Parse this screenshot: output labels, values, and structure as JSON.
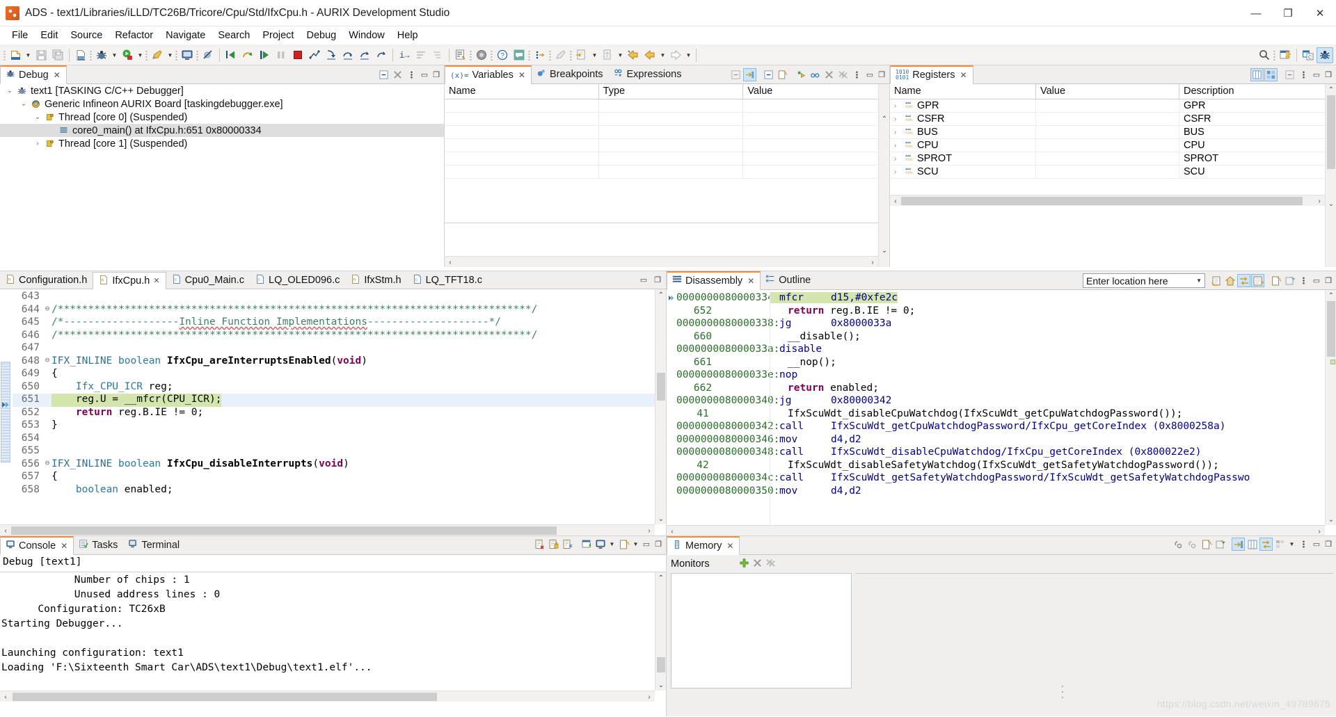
{
  "window": {
    "title": "ADS - text1/Libraries/iLLD/TC26B/Tricore/Cpu/Std/IfxCpu.h - AURIX Development Studio",
    "minimize": "—",
    "maximize": "❐",
    "close": "✕"
  },
  "menu": [
    "File",
    "Edit",
    "Source",
    "Refactor",
    "Navigate",
    "Search",
    "Project",
    "Debug",
    "Window",
    "Help"
  ],
  "debug_view": {
    "tab": "Debug",
    "tree": [
      {
        "indent": 0,
        "twisty": "⌄",
        "icon": "debug-launch-icon",
        "label": "text1 [TASKING C/C++ Debugger]",
        "selected": false
      },
      {
        "indent": 1,
        "twisty": "⌄",
        "icon": "target-board-icon",
        "label": "Generic Infineon AURIX Board [taskingdebugger.exe]",
        "selected": false
      },
      {
        "indent": 2,
        "twisty": "⌄",
        "icon": "thread-icon",
        "label": "Thread [core 0] (Suspended)",
        "selected": false
      },
      {
        "indent": 3,
        "twisty": "",
        "icon": "stack-frame-icon",
        "label": "core0_main() at IfxCpu.h:651 0x80000334",
        "selected": true
      },
      {
        "indent": 2,
        "twisty": "›",
        "icon": "thread-icon",
        "label": "Thread [core 1] (Suspended)",
        "selected": false
      }
    ]
  },
  "variables_view": {
    "tabs": [
      {
        "label": "Variables",
        "icon": "variables-icon",
        "selected": true,
        "closable": true
      },
      {
        "label": "Breakpoints",
        "icon": "breakpoints-icon",
        "selected": false,
        "closable": false
      },
      {
        "label": "Expressions",
        "icon": "expressions-icon",
        "selected": false,
        "closable": false
      }
    ],
    "columns": [
      "Name",
      "Type",
      "Value"
    ],
    "rows": [
      [],
      [],
      [],
      [],
      [],
      []
    ]
  },
  "registers_view": {
    "tab": "Registers",
    "columns": [
      "Name",
      "Value",
      "Description"
    ],
    "rows": [
      {
        "name": "GPR",
        "value": "",
        "description": "GPR"
      },
      {
        "name": "CSFR",
        "value": "",
        "description": "CSFR"
      },
      {
        "name": "BUS",
        "value": "",
        "description": "BUS"
      },
      {
        "name": "CPU",
        "value": "",
        "description": "CPU"
      },
      {
        "name": "SPROT",
        "value": "",
        "description": "SPROT"
      },
      {
        "name": "SCU",
        "value": "",
        "description": "SCU"
      }
    ]
  },
  "editor": {
    "tabs": [
      {
        "label": "Configuration.h",
        "type": "h",
        "selected": false,
        "closable": false
      },
      {
        "label": "IfxCpu.h",
        "type": "h",
        "selected": true,
        "closable": true
      },
      {
        "label": "Cpu0_Main.c",
        "type": "c",
        "selected": false,
        "closable": false
      },
      {
        "label": "LQ_OLED096.c",
        "type": "c",
        "selected": false,
        "closable": false
      },
      {
        "label": "IfxStm.h",
        "type": "h",
        "selected": false,
        "closable": false
      },
      {
        "label": "LQ_TFT18.c",
        "type": "c",
        "selected": false,
        "closable": false
      }
    ],
    "lines": [
      {
        "no": "643",
        "fold": "",
        "text": "",
        "style": "plain",
        "highlight": "none"
      },
      {
        "no": "644",
        "fold": "⊖",
        "text": "/******************************************************************************/",
        "style": "comment",
        "highlight": "none"
      },
      {
        "no": "645",
        "fold": "",
        "text": "/*-------------------Inline Function Implementations--------------------*/",
        "style": "comment-underline",
        "highlight": "none"
      },
      {
        "no": "646",
        "fold": "",
        "text": "/******************************************************************************/",
        "style": "comment",
        "highlight": "none"
      },
      {
        "no": "647",
        "fold": "",
        "text": "",
        "style": "plain",
        "highlight": "none"
      },
      {
        "no": "648",
        "fold": "⊖",
        "text": "IFX_INLINE boolean IfxCpu_areInterruptsEnabled(void)",
        "style": "decl",
        "highlight": "none"
      },
      {
        "no": "649",
        "fold": "",
        "text": "{",
        "style": "plain",
        "highlight": "none"
      },
      {
        "no": "650",
        "fold": "",
        "text": "    Ifx_CPU_ICR reg;",
        "style": "plain",
        "highlight": "none"
      },
      {
        "no": "651",
        "fold": "",
        "text": "    reg.U = __mfcr(CPU_ICR);",
        "style": "plain",
        "highlight": "current"
      },
      {
        "no": "652",
        "fold": "",
        "text": "    return reg.B.IE != 0;",
        "style": "ret",
        "highlight": "none"
      },
      {
        "no": "653",
        "fold": "",
        "text": "}",
        "style": "plain",
        "highlight": "none"
      },
      {
        "no": "654",
        "fold": "",
        "text": "",
        "style": "plain",
        "highlight": "none"
      },
      {
        "no": "655",
        "fold": "",
        "text": "",
        "style": "plain",
        "highlight": "none"
      },
      {
        "no": "656",
        "fold": "⊖",
        "text": "IFX_INLINE boolean IfxCpu_disableInterrupts(void)",
        "style": "decl",
        "highlight": "none"
      },
      {
        "no": "657",
        "fold": "",
        "text": "{",
        "style": "plain",
        "highlight": "none"
      },
      {
        "no": "658",
        "fold": "",
        "text": "    boolean enabled;",
        "style": "plain",
        "highlight": "none"
      }
    ]
  },
  "disassembly_view": {
    "tabs": [
      {
        "label": "Disassembly",
        "icon": "disassembly-icon",
        "selected": true,
        "closable": true
      },
      {
        "label": "Outline",
        "icon": "outline-icon",
        "selected": false,
        "closable": false
      }
    ],
    "location_placeholder": "Enter location here",
    "rows": [
      {
        "kind": "instr",
        "marker": true,
        "addr": "0000000080000334:",
        "op": "mfcr",
        "arg": "d15,#0xfe2c",
        "highlight": true
      },
      {
        "kind": "source",
        "lineno": "652",
        "text": "return reg.B.IE != 0;",
        "keyword": "return"
      },
      {
        "kind": "instr",
        "marker": false,
        "addr": "0000000080000338:",
        "op": "jg",
        "arg": "0x8000033a",
        "highlight": false
      },
      {
        "kind": "source",
        "lineno": "660",
        "text": "__disable();",
        "keyword": ""
      },
      {
        "kind": "instr",
        "marker": false,
        "addr": "000000008000033a:",
        "op": "disable",
        "arg": "",
        "highlight": false
      },
      {
        "kind": "source",
        "lineno": "661",
        "text": "__nop();",
        "keyword": ""
      },
      {
        "kind": "instr",
        "marker": false,
        "addr": "000000008000033e:",
        "op": "nop",
        "arg": "",
        "highlight": false
      },
      {
        "kind": "source",
        "lineno": "662",
        "text": "return enabled;",
        "keyword": "return"
      },
      {
        "kind": "instr",
        "marker": false,
        "addr": "0000000080000340:",
        "op": "jg",
        "arg": "0x80000342",
        "highlight": false
      },
      {
        "kind": "source",
        "lineno": "41",
        "text": "IfxScuWdt_disableCpuWatchdog(IfxScuWdt_getCpuWatchdogPassword());",
        "keyword": ""
      },
      {
        "kind": "instr",
        "marker": false,
        "addr": "0000000080000342:",
        "op": "call",
        "arg": "IfxScuWdt_getCpuWatchdogPassword/IfxCpu_getCoreIndex (0x8000258a)",
        "highlight": false
      },
      {
        "kind": "instr",
        "marker": false,
        "addr": "0000000080000346:",
        "op": "mov",
        "arg": "d4,d2",
        "highlight": false
      },
      {
        "kind": "instr",
        "marker": false,
        "addr": "0000000080000348:",
        "op": "call",
        "arg": "IfxScuWdt_disableCpuWatchdog/IfxCpu_getCoreIndex (0x800022e2)",
        "highlight": false
      },
      {
        "kind": "source",
        "lineno": "42",
        "text": "IfxScuWdt_disableSafetyWatchdog(IfxScuWdt_getSafetyWatchdogPassword());",
        "keyword": ""
      },
      {
        "kind": "instr",
        "marker": false,
        "addr": "000000008000034c:",
        "op": "call",
        "arg": "IfxScuWdt_getSafetyWatchdogPassword/IfxScuWdt_getSafetyWatchdogPasswo",
        "highlight": false
      },
      {
        "kind": "instr",
        "marker": false,
        "addr": "0000000080000350:",
        "op": "mov",
        "arg": "d4,d2",
        "highlight": false
      }
    ]
  },
  "console_view": {
    "tabs": [
      {
        "label": "Console",
        "icon": "console-icon",
        "selected": true,
        "closable": true
      },
      {
        "label": "Tasks",
        "icon": "tasks-icon",
        "selected": false,
        "closable": false
      },
      {
        "label": "Terminal",
        "icon": "terminal-icon",
        "selected": false,
        "closable": false
      }
    ],
    "header": "Debug [text1]",
    "lines": [
      "            Number of chips : 1",
      "            Unused address lines : 0",
      "      Configuration: TC26xB",
      "Starting Debugger...",
      "",
      "Launching configuration: text1",
      "Loading 'F:\\Sixteenth Smart Car\\ADS\\text1\\Debug\\text1.elf'..."
    ]
  },
  "memory_view": {
    "tab": "Memory",
    "monitors_label": "Monitors",
    "add_monitor": "+",
    "remove_monitor": "✕",
    "remove_all_monitors": "✕"
  },
  "watermark": "https://blog.csdn.net/weixin_49789675",
  "colors": {
    "accent": "#ff8a33",
    "select_row": "#dedede",
    "code_highlight_green": "#d4e6ad",
    "code_highlight_blue": "#e8f1fb",
    "toolbar_bg": "#f4f3f2",
    "tab_bg": "#f0efee"
  }
}
